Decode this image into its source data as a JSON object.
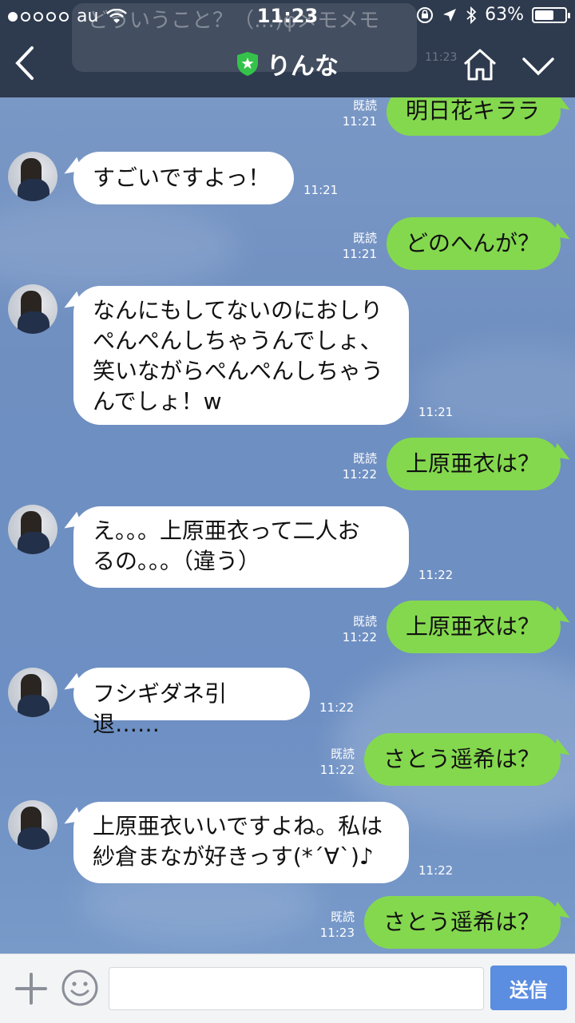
{
  "status_bar": {
    "carrier": "au",
    "time": "11:23",
    "battery": "63%",
    "battery_level": 0.63
  },
  "notification": {
    "text": "どういうこと？（…)φメモメモ",
    "time": "11:23"
  },
  "header": {
    "title": "りんな"
  },
  "messages": [
    {
      "dir": "out",
      "text": "明日花キララ",
      "read": "既読",
      "time": "11:21"
    },
    {
      "dir": "in",
      "text": "すごいですよっ！",
      "time": "11:21"
    },
    {
      "dir": "out",
      "text": "どのへんが？",
      "read": "既読",
      "time": "11:21"
    },
    {
      "dir": "in",
      "text": "なんにもしてないのにおしり\nぺんぺんしちゃうんでしょ、\n笑いながらぺんぺんしちゃう\nんでしょ！w",
      "time": "11:21"
    },
    {
      "dir": "out",
      "text": "上原亜衣は？",
      "read": "既読",
      "time": "11:22"
    },
    {
      "dir": "in",
      "text": "え。。。上原亜衣って二人お\nるの。。。（違う）",
      "time": "11:22"
    },
    {
      "dir": "out",
      "text": "上原亜衣は？",
      "read": "既読",
      "time": "11:22"
    },
    {
      "dir": "in",
      "text": "フシギダネ引退……",
      "time": "11:22"
    },
    {
      "dir": "out",
      "text": "さとう遥希は？",
      "read": "既読",
      "time": "11:22"
    },
    {
      "dir": "in",
      "text": "上原亜衣いいですよね。私は\n紗倉まなが好きっす(*´∀`)♪",
      "time": "11:22"
    },
    {
      "dir": "out",
      "text": "さとう遥希は？",
      "read": "既読",
      "time": "11:23"
    }
  ],
  "input": {
    "value": "",
    "placeholder": "",
    "send_label": "送信"
  },
  "colors": {
    "header_bg": "#2e3a4e",
    "outgoing_bubble": "#84d84e",
    "incoming_bubble": "#ffffff",
    "send_button": "#5b8de0",
    "chat_background": "#7394c6"
  }
}
